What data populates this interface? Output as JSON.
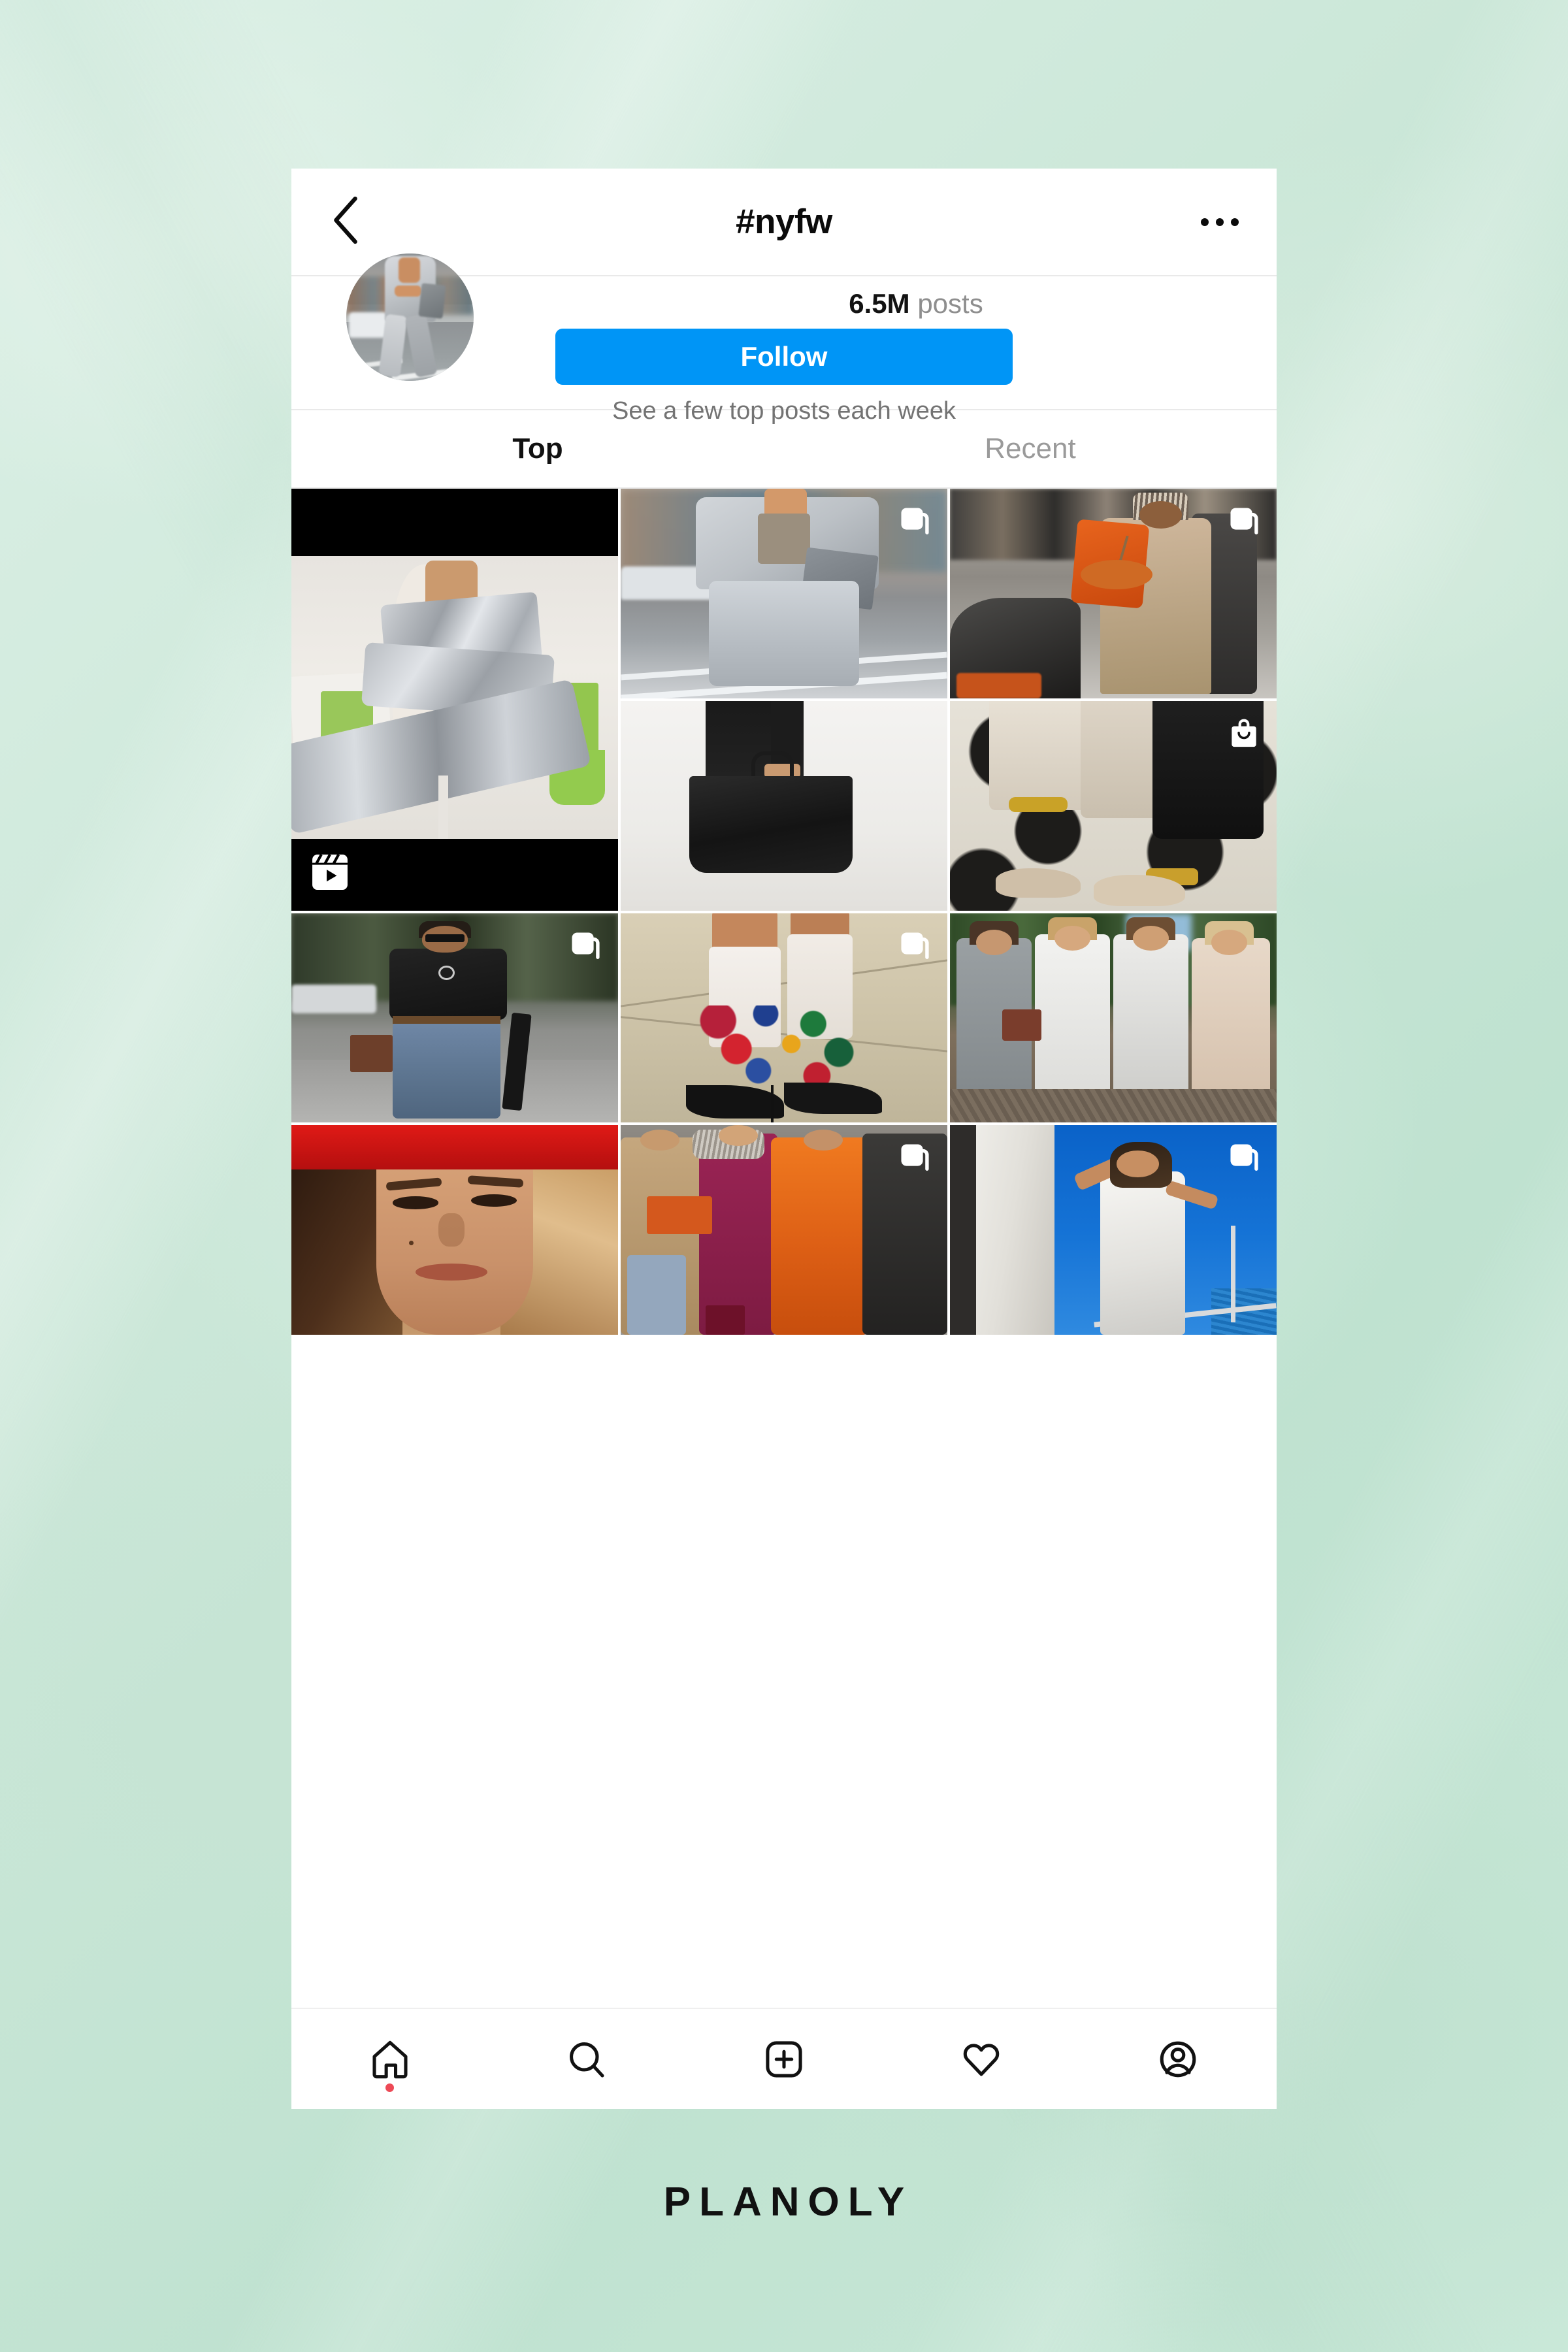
{
  "background": {
    "accent_mint": "#cfe8da",
    "brand_blue": "#0095f6",
    "notification_red": "#ed4956"
  },
  "header": {
    "title": "#nyfw",
    "back_icon": "chevron-left-icon",
    "more_icon": "more-options-icon"
  },
  "profile": {
    "avatar_alt": "hashtag-avatar",
    "posts_count": "6.5M",
    "posts_label": "posts",
    "follow_label": "Follow",
    "subtitle": "See a few top posts each week"
  },
  "tabs": [
    {
      "label": "Top",
      "active": true
    },
    {
      "label": "Recent",
      "active": false
    }
  ],
  "grid": {
    "tiles": [
      {
        "id": "t1",
        "alt": "sequin-dress-mannequin-reel",
        "badge": "reel-icon",
        "tall": true
      },
      {
        "id": "t2",
        "alt": "grey-blazer-street-style",
        "badge": "carousel-icon",
        "tall": false
      },
      {
        "id": "t3",
        "alt": "orange-coat-crosswalk",
        "badge": "carousel-icon",
        "tall": false
      },
      {
        "id": "t4",
        "alt": "black-tote-bag",
        "badge": "none",
        "tall": false
      },
      {
        "id": "t5",
        "alt": "polka-dot-floor-shoes",
        "badge": "shopping-bag-icon",
        "tall": false
      },
      {
        "id": "t6",
        "alt": "man-black-sweater-jeans",
        "badge": "carousel-icon",
        "tall": false
      },
      {
        "id": "t7",
        "alt": "polka-dot-socks-heels",
        "badge": "carousel-icon",
        "tall": false
      },
      {
        "id": "t8",
        "alt": "four-women-walking",
        "badge": "none",
        "tall": false
      },
      {
        "id": "t9",
        "alt": "portrait-red-hat",
        "badge": "none",
        "tall": false
      },
      {
        "id": "t10",
        "alt": "colorful-winter-coats",
        "badge": "carousel-icon",
        "tall": false
      },
      {
        "id": "t11",
        "alt": "white-dress-on-yacht",
        "badge": "carousel-icon",
        "tall": false
      }
    ]
  },
  "bottom_nav": [
    {
      "icon": "home-icon",
      "name": "nav-home",
      "has_dot": true
    },
    {
      "icon": "search-icon",
      "name": "nav-search",
      "has_dot": false
    },
    {
      "icon": "add-post-icon",
      "name": "nav-create",
      "has_dot": false
    },
    {
      "icon": "heart-icon",
      "name": "nav-activity",
      "has_dot": false
    },
    {
      "icon": "profile-icon",
      "name": "nav-profile",
      "has_dot": false
    }
  ],
  "brand": {
    "name": "PLANOLY"
  }
}
